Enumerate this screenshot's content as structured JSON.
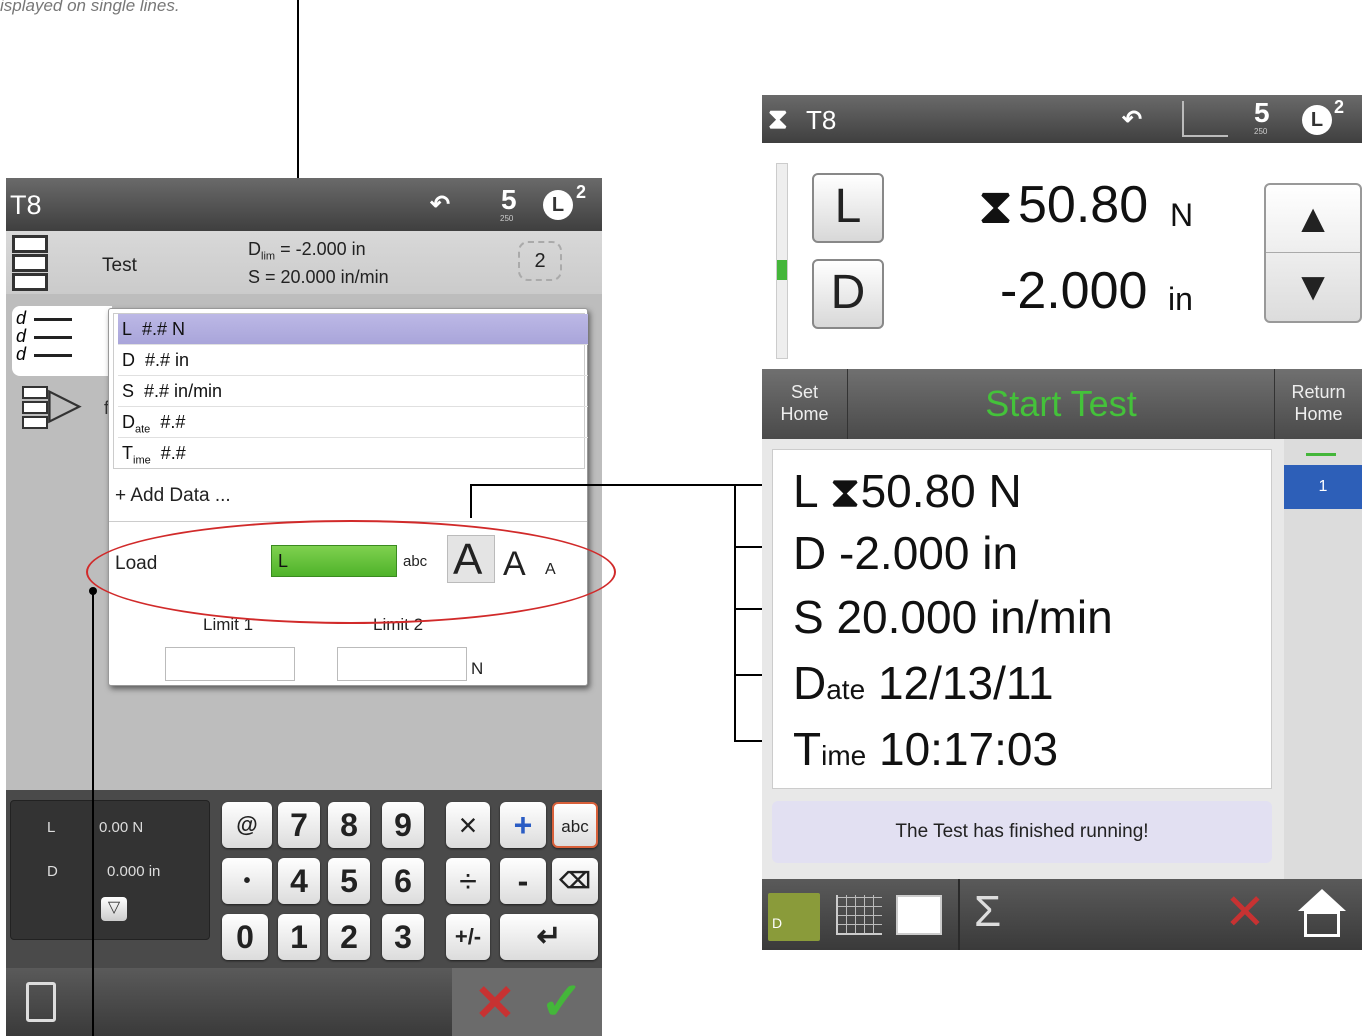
{
  "caption": "isplayed on single lines.",
  "left": {
    "title": "T8",
    "icon_five": "5",
    "icon_five_sub": "250",
    "icon_l": "L",
    "icon_two": "2",
    "header": {
      "test_label": "Test",
      "dlim_prefix": "D",
      "dlim_sub": "lim",
      "dlim_value": " = -2.000 in",
      "speed": "S = 20.000 in/min",
      "counter": "2"
    },
    "tab_d_letters": [
      "d",
      "d",
      "d"
    ],
    "tab2_letter": "f",
    "popup": {
      "rows": [
        {
          "prefix": "L",
          "sub": "",
          "value": "#.# N",
          "selected": true
        },
        {
          "prefix": "D",
          "sub": "",
          "value": "#.# in",
          "selected": false
        },
        {
          "prefix": "S",
          "sub": "",
          "value": "#.# in/min",
          "selected": false
        },
        {
          "prefix": "D",
          "sub": "ate",
          "value": "#.#",
          "selected": false
        },
        {
          "prefix": "T",
          "sub": "ime",
          "value": "#.#",
          "selected": false
        }
      ],
      "add_data": "+ Add Data ...",
      "field_label": "Load",
      "field_value": "L",
      "abc": "abc",
      "font_large": "A",
      "font_medium": "A",
      "font_small": "A",
      "limit1": "Limit 1",
      "limit2": "Limit 2",
      "limit_unit": "N"
    },
    "live": {
      "l_label": "L",
      "l_value": "0.00 N",
      "d_label": "D",
      "d_value": "0.000 in"
    },
    "keypad": {
      "row1": [
        "@",
        "7",
        "8",
        "9",
        "×",
        "+",
        "abc"
      ],
      "row2": [
        "•",
        "4",
        "5",
        "6",
        "÷",
        "-",
        "⌫"
      ],
      "row3": [
        "0",
        "1",
        "2",
        "3",
        "+/-",
        "↵"
      ]
    }
  },
  "right": {
    "title": "T8",
    "icon_five": "5",
    "icon_five_sub": "250",
    "icon_l": "L",
    "icon_two": "2",
    "l_button": "L",
    "d_button": "D",
    "load_value": "50.80",
    "load_unit": "N",
    "disp_value": "-2.000",
    "disp_unit": "in",
    "set_home": [
      "Set",
      "Home"
    ],
    "start_test": "Start Test",
    "return_home": [
      "Return",
      "Home"
    ],
    "side_num": "1",
    "data": [
      {
        "prefix": "L",
        "sub": "",
        "value": "50.80 N"
      },
      {
        "prefix": "D",
        "sub": "",
        "value": "-2.000 in"
      },
      {
        "prefix": "S",
        "sub": "",
        "value": "20.000 in/min"
      },
      {
        "prefix": "D",
        "sub": "ate",
        "value": "12/13/11"
      },
      {
        "prefix": "T",
        "sub": "ime",
        "value": "10:17:03"
      }
    ],
    "status": "The Test has finished running!",
    "bottom_d_letter": "D",
    "sigma": "Σ",
    "x_mark": "✕",
    "accent_green": "#4fc43a",
    "accent_blue": "#2d5fb8"
  }
}
